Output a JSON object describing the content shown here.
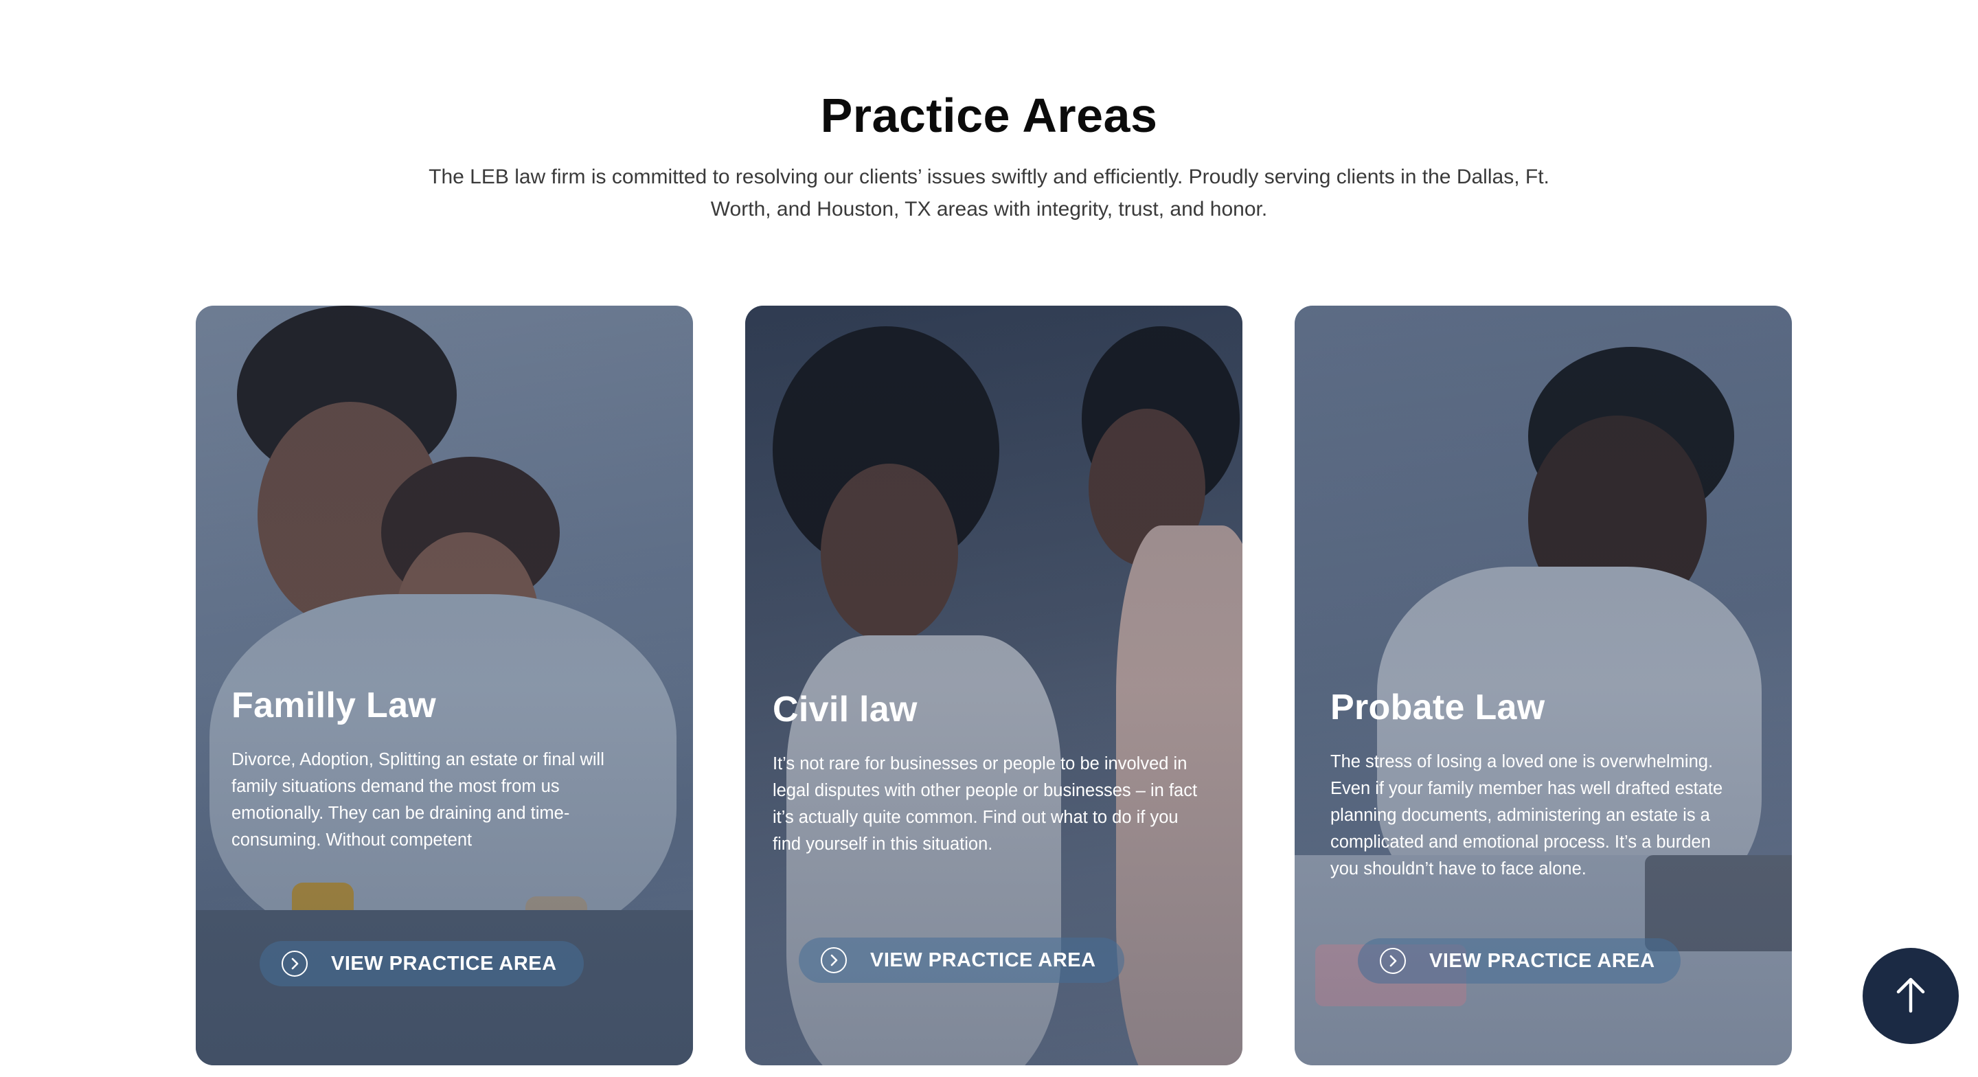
{
  "section": {
    "title": "Practice Areas",
    "intro": "The LEB law firm is committed to resolving our clients’ issues swiftly and efficiently. Proudly serving clients in the Dallas, Ft. Worth, and Houston, TX areas with integrity, trust, and honor."
  },
  "cards": [
    {
      "title": "Familly Law",
      "description": "Divorce, Adoption, Splitting an estate or final will family situations demand the most from us emotionally. They can be draining and time-consuming. Without competent",
      "button_label": "VIEW PRACTICE AREA",
      "button_icon": "chevron-right-circle-icon"
    },
    {
      "title": "Civil law",
      "description": "It’s not rare for businesses or people to be involved in legal disputes with other people or businesses – in fact it’s actually quite common. Find out what to do if you find yourself in this situation.",
      "button_label": "VIEW PRACTICE AREA",
      "button_icon": "chevron-right-circle-icon"
    },
    {
      "title": "Probate Law",
      "description": "The stress of losing a loved one is overwhelming. Even if your family member has well drafted estate planning documents, administering an estate is a complicated and emotional process. It’s a burden you shouldn’t have to face alone.",
      "button_label": "VIEW PRACTICE AREA",
      "button_icon": "chevron-right-circle-icon"
    }
  ],
  "scroll_top": {
    "icon": "arrow-up-icon"
  },
  "colors": {
    "overlay": "#1b2b48",
    "button_bg": "#466e96",
    "scroll_top_bg": "#1b2a44",
    "title": "#0b0b0b",
    "text": "#3a3a3a"
  }
}
